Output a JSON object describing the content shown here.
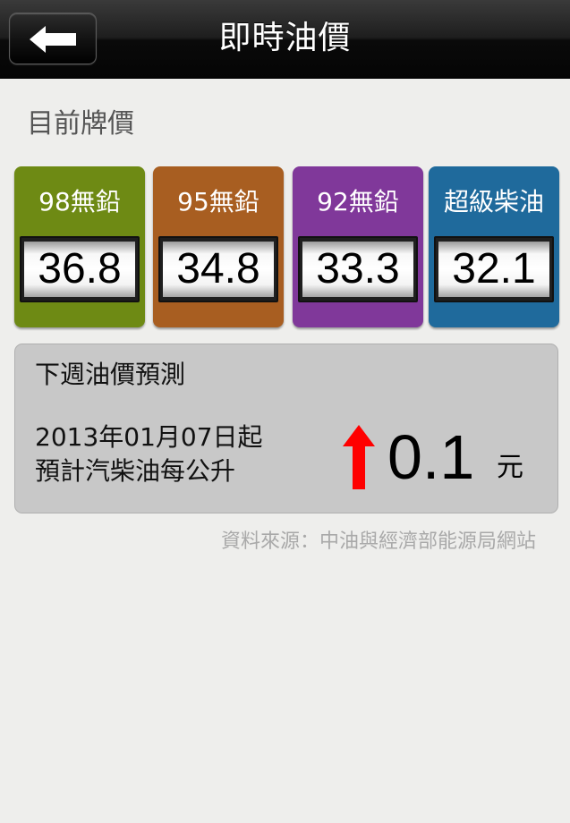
{
  "navbar": {
    "title": "即時油價",
    "back_icon": "left-arrow-icon"
  },
  "current": {
    "title": "目前牌價",
    "prices": [
      {
        "label": "98無鉛",
        "value": "36.8",
        "color": "#6e8a14"
      },
      {
        "label": "95無鉛",
        "value": "34.8",
        "color": "#a85e21"
      },
      {
        "label": "92無鉛",
        "value": "33.3",
        "color": "#80389a"
      },
      {
        "label": "超級柴油",
        "value": "32.1",
        "color": "#1f6a9c"
      }
    ]
  },
  "forecast": {
    "title": "下週油價預測",
    "date_text": "2013年01月07日起",
    "desc_text": "預計汽柴油每公升",
    "direction_icon": "up-arrow-icon",
    "direction_color": "#ff0000",
    "amount": "0.1",
    "unit": "元"
  },
  "source": "資料來源：中油與經濟部能源局網站"
}
